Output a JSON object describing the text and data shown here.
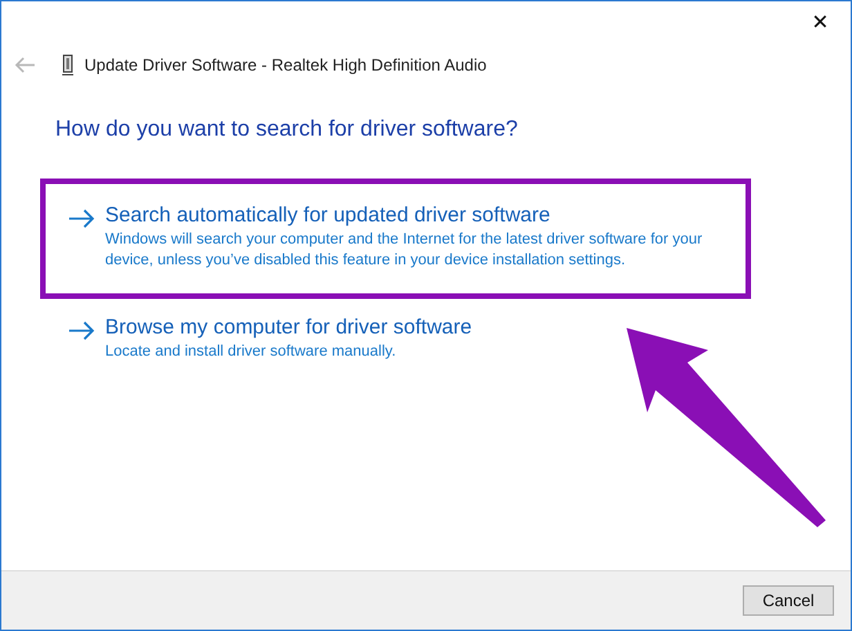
{
  "window": {
    "title": "Update Driver Software - Realtek High Definition Audio",
    "close": "✕"
  },
  "heading": "How do you want to search for driver software?",
  "options": [
    {
      "title": "Search automatically for updated driver software",
      "description": "Windows will search your computer and the Internet for the latest driver software for your device, unless you’ve disabled this feature in your device installation settings.",
      "highlighted": true
    },
    {
      "title": "Browse my computer for driver software",
      "description": "Locate and install driver software manually.",
      "highlighted": false
    }
  ],
  "buttons": [
    "Cancel"
  ]
}
